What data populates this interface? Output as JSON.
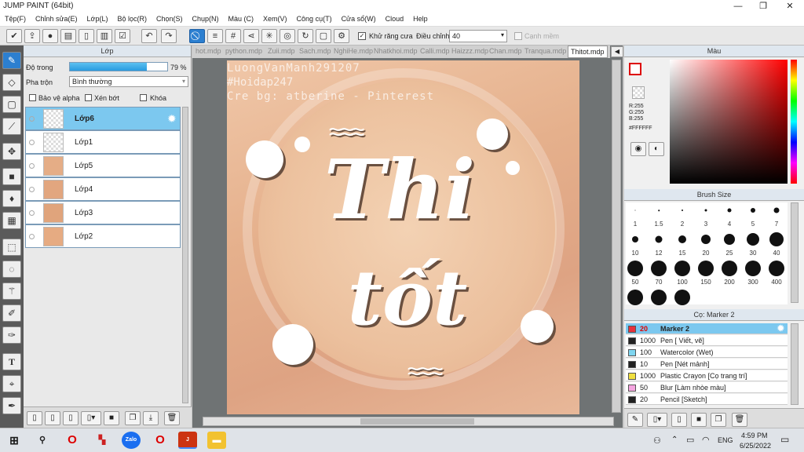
{
  "window": {
    "title": "JUMP PAINT (64bit)",
    "min": "—",
    "max": "❐",
    "close": "✕"
  },
  "menu": [
    "Tệp(F)",
    "Chỉnh sửa(E)",
    "Lớp(L)",
    "Bộ lọc(R)",
    "Chọn(S)",
    "Chụp(N)",
    "Màu (C)",
    "Xem(V)",
    "Công cụ(T)",
    "Cửa sổ(W)",
    "Cloud",
    "Help"
  ],
  "toolbar": {
    "antialias_label": "Khử răng cưa",
    "adjust_label": "Điều chỉnh",
    "adjust_value": "40",
    "edge_label": "Cạnh mềm"
  },
  "layer_panel": {
    "title": "Lớp",
    "opacity_label": "Độ trong",
    "opacity_value": "79 %",
    "opacity": 0.79,
    "blend_label": "Pha trộn",
    "blend_value": "Bình thường",
    "protect_alpha": "Bảo vệ alpha",
    "clip": "Xén bớt",
    "lock": "Khóa",
    "layers": [
      {
        "name": "Lớp6",
        "selected": true
      },
      {
        "name": "Lớp1"
      },
      {
        "name": "Lớp5"
      },
      {
        "name": "Lớp4"
      },
      {
        "name": "Lớp3"
      },
      {
        "name": "Lớp2"
      }
    ]
  },
  "tabs": [
    "hot.mdp",
    "python.mdp",
    "Zuii.mdp",
    "Sach.mdp",
    "NghiHe.mdp",
    "Nhatkhoi.mdp",
    "Calli.mdp",
    "Haizzz.mdp",
    "Chan.mdp",
    "Tranqua.mdp",
    "Thitot.mdp"
  ],
  "artwork": {
    "watermark1": "LuongVanManh291207",
    "watermark2": "#Hoidap247",
    "watermark3": "Cre bg: atberine - Pinterest",
    "word1": "Thi",
    "word2": "tốt"
  },
  "color_panel": {
    "title": "Màu",
    "r": "R:255",
    "g": "G:255",
    "b": "B:255",
    "hex": "#FFFFFF"
  },
  "brush_panel": {
    "title": "Brush Size",
    "sizes": [
      "1",
      "1.5",
      "2",
      "3",
      "4",
      "5",
      "7",
      "10",
      "12",
      "15",
      "20",
      "25",
      "30",
      "40",
      "50",
      "70",
      "100",
      "150",
      "200",
      "300",
      "400"
    ]
  },
  "marker_panel": {
    "title": "Cọ: Marker 2",
    "items": [
      {
        "size": "20",
        "name": "Marker 2",
        "color": "#e8323c",
        "selected": true
      },
      {
        "size": "1000",
        "name": "Pen [ Viết, vẽ]",
        "color": "#222222"
      },
      {
        "size": "100",
        "name": "Watercolor (Wet)",
        "color": "#7fd6f0"
      },
      {
        "size": "10",
        "name": "Pen [Nét mảnh]",
        "color": "#222222"
      },
      {
        "size": "1000",
        "name": "Plastic Crayon [Cọ trang trí]",
        "color": "#f0e040"
      },
      {
        "size": "50",
        "name": "Blur [Làm nhòe màu]",
        "color": "#f5a5e0"
      },
      {
        "size": "20",
        "name": "Pencil [Sketch]",
        "color": "#222222"
      }
    ]
  },
  "taskbar": {
    "time": "4:59 PM",
    "date": "6/25/2022",
    "lang": "ENG"
  }
}
